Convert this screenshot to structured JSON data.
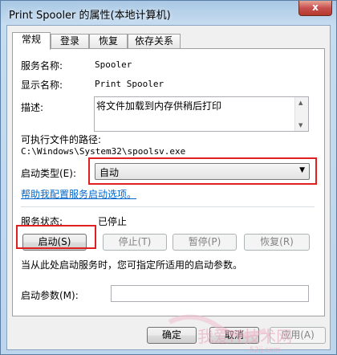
{
  "window": {
    "title": "Print Spooler 的属性(本地计算机)",
    "close_glyph": "x"
  },
  "tabs": [
    {
      "label": "常规"
    },
    {
      "label": "登录"
    },
    {
      "label": "恢复"
    },
    {
      "label": "依存关系"
    }
  ],
  "general": {
    "service_name_label": "服务名称:",
    "service_name_value": "Spooler",
    "display_name_label": "显示名称:",
    "display_name_value": "Print Spooler",
    "description_label": "描述:",
    "description_value": "将文件加载到内存供稍后打印",
    "exe_path_label": "可执行文件的路径:",
    "exe_path_value": "C:\\Windows\\System32\\spoolsv.exe",
    "startup_type_label": "启动类型(E):",
    "startup_type_value": "自动",
    "help_link": "帮助我配置服务启动选项。",
    "status_label": "服务状态:",
    "status_value": "已停止",
    "start_button": "启动(S)",
    "stop_button": "停止(T)",
    "pause_button": "暂停(P)",
    "resume_button": "恢复(R)",
    "hint_text": "当从此处启动服务时，您可指定所适用的启动参数。",
    "start_params_label": "启动参数(M):"
  },
  "footer": {
    "ok_button": "确定",
    "cancel_button": "取消",
    "apply_button": "应用(A)"
  },
  "watermark": {
    "text": "我爱IT技术网",
    "sub": "52ij.com"
  },
  "colors": {
    "highlight_box": "#e02020",
    "link": "#0066cc"
  }
}
